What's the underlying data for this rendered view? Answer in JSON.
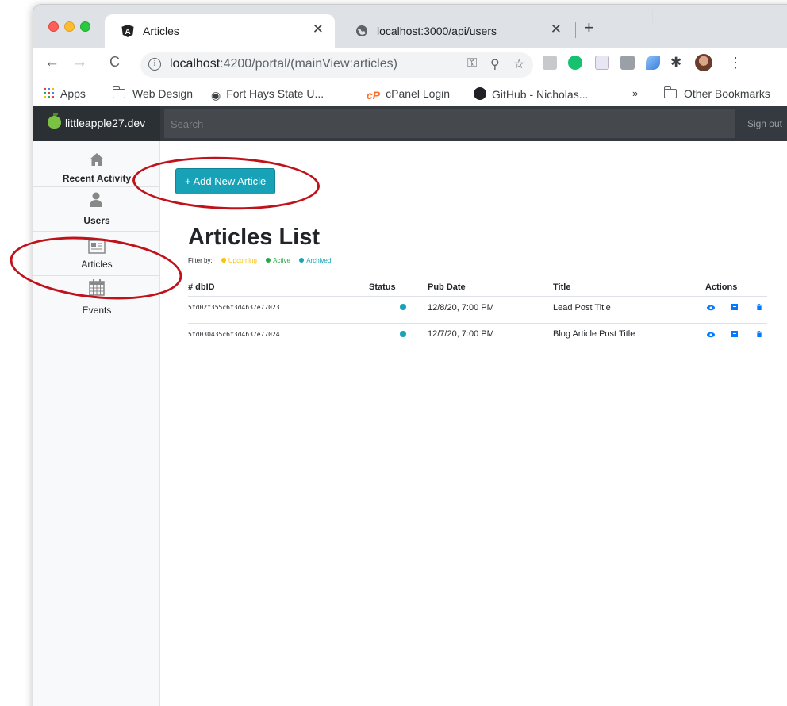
{
  "browser": {
    "tabs": [
      {
        "title": "Articles",
        "favicon": "angular-icon"
      },
      {
        "title": "localhost:3000/api/users",
        "favicon": "globe-icon"
      }
    ],
    "url": {
      "host": "localhost",
      "rest": ":4200/portal/(mainView:articles)"
    },
    "bookmarks": {
      "apps": "Apps",
      "web_design": "Web Design",
      "fort_hays": "Fort Hays State U...",
      "cpanel": "cPanel Login",
      "github": "GitHub - Nicholas...",
      "more": "»",
      "other": "Other Bookmarks"
    }
  },
  "app": {
    "brand": "littleapple27.dev",
    "search_placeholder": "Search",
    "sign_out": "Sign out",
    "sidebar": [
      {
        "label": "Recent Activity",
        "icon": "home-icon"
      },
      {
        "label": "Users",
        "icon": "user-icon"
      },
      {
        "label": "Articles",
        "icon": "newspaper-icon"
      },
      {
        "label": "Events",
        "icon": "calendar-icon"
      }
    ],
    "add_button": "+ Add New Article",
    "list_title": "Articles List",
    "filter": {
      "label": "Filter by:",
      "options": [
        {
          "label": "Upcoming",
          "color": "#ffc107"
        },
        {
          "label": "Active",
          "color": "#28a745"
        },
        {
          "label": "Archived",
          "color": "#17a2b8"
        }
      ]
    },
    "table": {
      "headers": [
        "# dbID",
        "Status",
        "Pub Date",
        "Title",
        "Actions"
      ],
      "rows": [
        {
          "id": "5fd02f355c6f3d4b37e77023",
          "status_color": "#17a2b8",
          "date": "12/8/20, 7:00 PM",
          "title": "Lead Post Title"
        },
        {
          "id": "5fd030435c6f3d4b37e77024",
          "status_color": "#17a2b8",
          "date": "12/7/20, 7:00 PM",
          "title": "Blog Article Post Title"
        }
      ]
    }
  },
  "colors": {
    "accent": "#17a2b8",
    "annotation": "#c0121a",
    "action_blue": "#007bff"
  }
}
